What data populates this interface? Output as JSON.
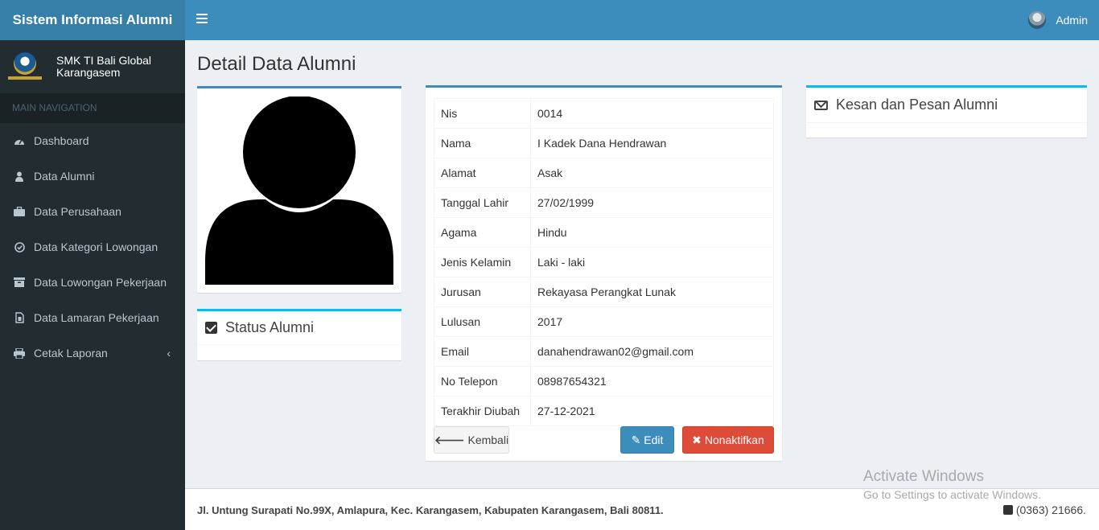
{
  "app": {
    "brand": "Sistem Informasi Alumni"
  },
  "header": {
    "user_label": "Admin"
  },
  "sidebar": {
    "school_name_line1": "SMK TI Bali Global",
    "school_name_line2": "Karangasem",
    "nav_header": "MAIN NAVIGATION",
    "items": [
      {
        "label": "Dashboard",
        "icon": "dashboard-icon"
      },
      {
        "label": "Data Alumni",
        "icon": "user-icon"
      },
      {
        "label": "Data Perusahaan",
        "icon": "briefcase-icon"
      },
      {
        "label": "Data Kategori Lowongan",
        "icon": "check-circle-icon"
      },
      {
        "label": "Data Lowongan Pekerjaan",
        "icon": "archive-icon"
      },
      {
        "label": "Data Lamaran Pekerjaan",
        "icon": "file-icon"
      },
      {
        "label": "Cetak Laporan",
        "icon": "print-icon"
      }
    ]
  },
  "page": {
    "title": "Detail Data Alumni"
  },
  "status_box": {
    "title": "Status Alumni"
  },
  "detail": {
    "rows": [
      {
        "key": "Nis",
        "value": "0014"
      },
      {
        "key": "Nama",
        "value": "I Kadek Dana Hendrawan"
      },
      {
        "key": "Alamat",
        "value": "Asak"
      },
      {
        "key": "Tanggal Lahir",
        "value": "27/02/1999"
      },
      {
        "key": "Agama",
        "value": "Hindu"
      },
      {
        "key": "Jenis Kelamin",
        "value": "Laki - laki"
      },
      {
        "key": "Jurusan",
        "value": "Rekayasa Perangkat Lunak"
      },
      {
        "key": "Lulusan",
        "value": "2017"
      },
      {
        "key": "Email",
        "value": "danahendrawan02@gmail.com"
      },
      {
        "key": "No Telepon",
        "value": "08987654321"
      },
      {
        "key": "Terakhir Diubah",
        "value": "27-12-2021"
      }
    ],
    "buttons": {
      "back": "Kembali",
      "edit": "Edit",
      "deactivate": "Nonaktifkan"
    }
  },
  "message_box": {
    "title": "Kesan dan Pesan Alumni"
  },
  "footer": {
    "address": "Jl. Untung Surapati No.99X, Amlapura, Kec. Karangasem, Kabupaten Karangasem, Bali 80811.",
    "phone": "(0363) 21666."
  },
  "watermark": {
    "line1": "Activate Windows",
    "line2": "Go to Settings to activate Windows."
  },
  "colors": {
    "header": "#3c8dbc",
    "brand": "#367fa9",
    "sidebar": "#222d32",
    "danger": "#dd4b39",
    "info": "#00c0ef"
  }
}
